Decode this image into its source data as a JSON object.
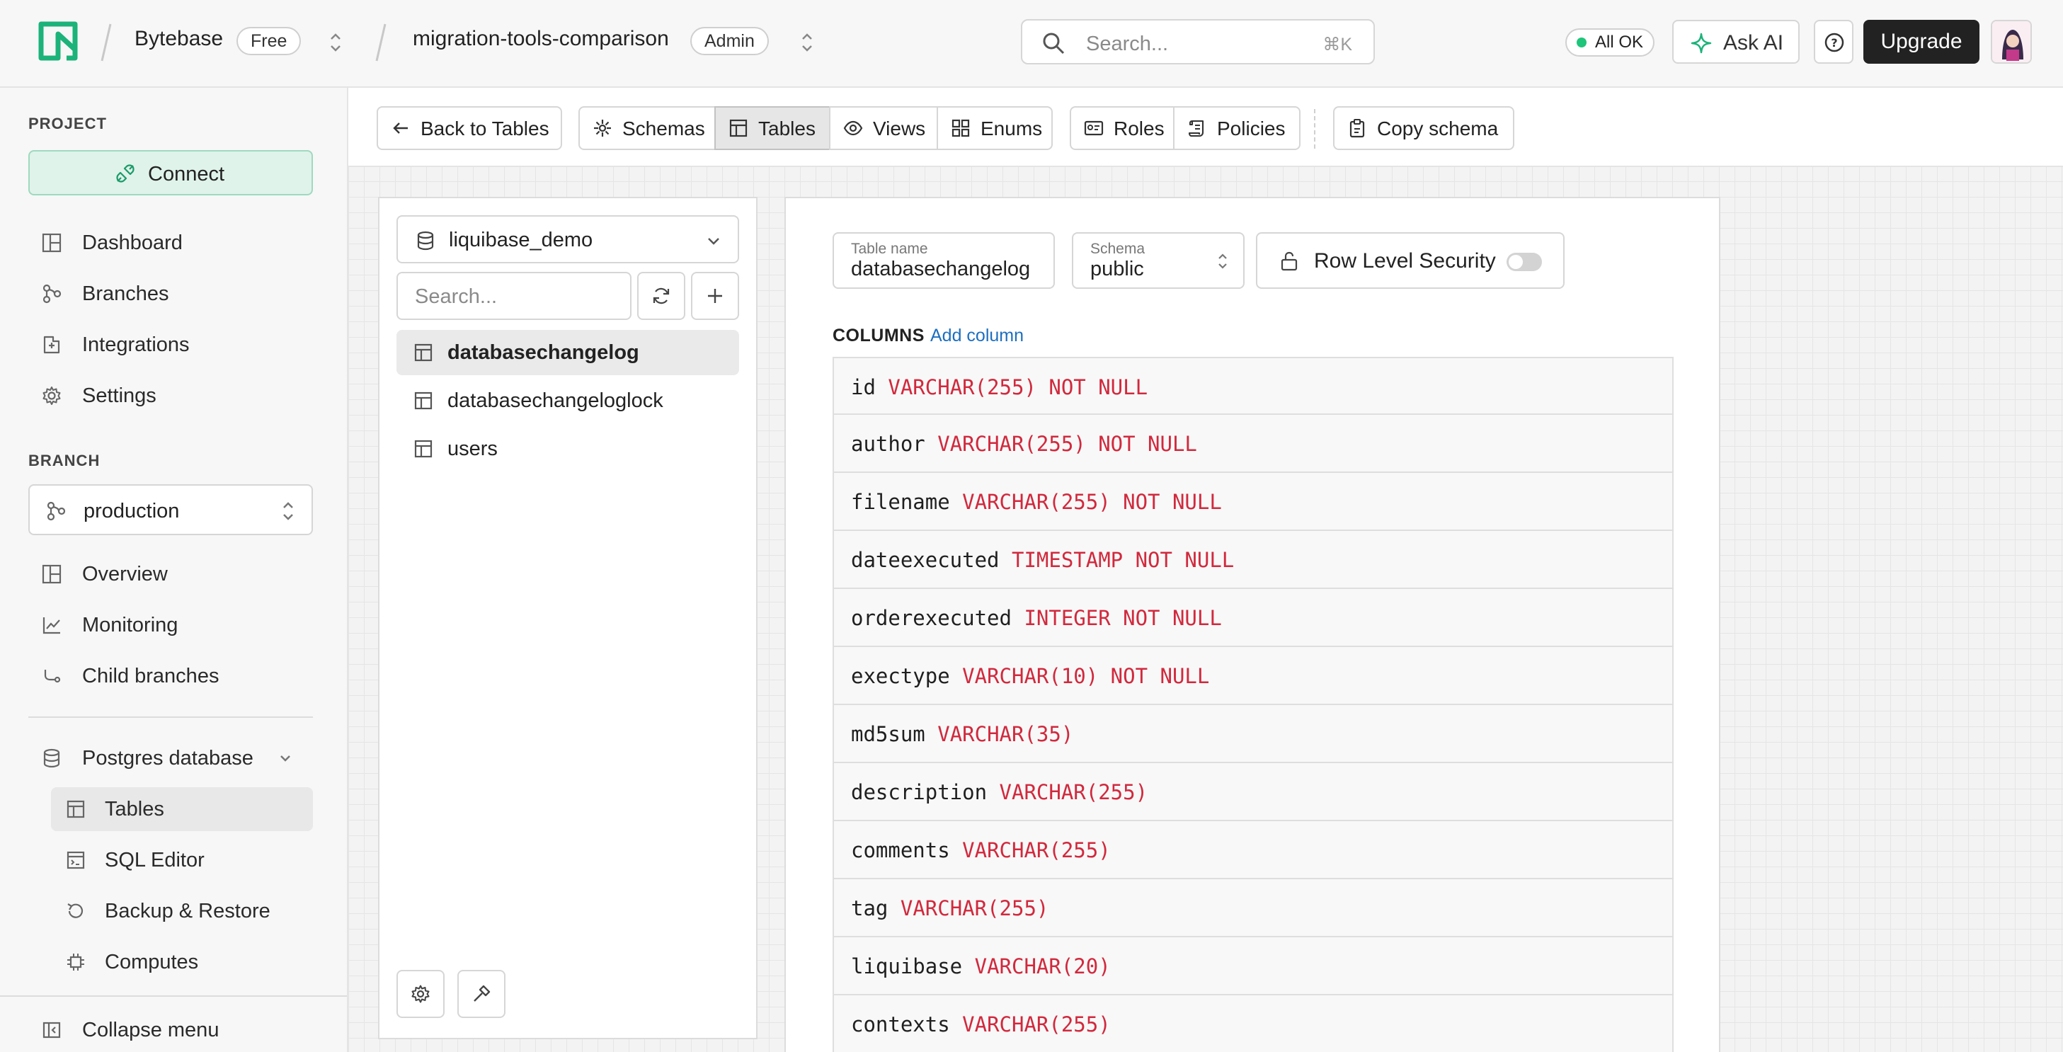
{
  "header": {
    "org_name": "Bytebase",
    "org_plan": "Free",
    "project_name": "migration-tools-comparison",
    "project_role": "Admin",
    "search_placeholder": "Search...",
    "search_shortcut": "⌘K",
    "status": "All OK",
    "ask_ai": "Ask AI",
    "upgrade": "Upgrade"
  },
  "sidebar": {
    "project_label": "PROJECT",
    "connect": "Connect",
    "project_items": [
      {
        "label": "Dashboard",
        "icon": "dashboard-icon"
      },
      {
        "label": "Branches",
        "icon": "branches-icon"
      },
      {
        "label": "Integrations",
        "icon": "integrations-icon"
      },
      {
        "label": "Settings",
        "icon": "gear-icon"
      }
    ],
    "branch_label": "BRANCH",
    "branch_value": "production",
    "branch_items": [
      {
        "label": "Overview",
        "icon": "overview-icon"
      },
      {
        "label": "Monitoring",
        "icon": "monitoring-icon"
      },
      {
        "label": "Child branches",
        "icon": "child-branch-icon"
      }
    ],
    "database_label": "Postgres database",
    "database_items": [
      {
        "label": "Tables",
        "icon": "table-icon",
        "active": true
      },
      {
        "label": "SQL Editor",
        "icon": "sql-editor-icon"
      },
      {
        "label": "Backup & Restore",
        "icon": "restore-icon"
      },
      {
        "label": "Computes",
        "icon": "chip-icon"
      }
    ],
    "collapse": "Collapse menu"
  },
  "toolbar": {
    "back": "Back to Tables",
    "schemas": "Schemas",
    "tables": "Tables",
    "views": "Views",
    "enums": "Enums",
    "roles": "Roles",
    "policies": "Policies",
    "copy_schema": "Copy schema"
  },
  "tables_panel": {
    "database": "liquibase_demo",
    "search_placeholder": "Search...",
    "tables": [
      "databasechangelog",
      "databasechangeloglock",
      "users"
    ],
    "active_table": "databasechangelog"
  },
  "detail": {
    "table_name_caption": "Table name",
    "table_name": "databasechangelog",
    "schema_caption": "Schema",
    "schema": "public",
    "rls_label": "Row Level Security",
    "rls_enabled": false,
    "columns_title": "COLUMNS",
    "add_column": "Add column",
    "columns": [
      {
        "name": "id",
        "type": "VARCHAR(255) NOT NULL"
      },
      {
        "name": "author",
        "type": "VARCHAR(255) NOT NULL"
      },
      {
        "name": "filename",
        "type": "VARCHAR(255) NOT NULL"
      },
      {
        "name": "dateexecuted",
        "type": "TIMESTAMP NOT NULL"
      },
      {
        "name": "orderexecuted",
        "type": "INTEGER NOT NULL"
      },
      {
        "name": "exectype",
        "type": "VARCHAR(10) NOT NULL"
      },
      {
        "name": "md5sum",
        "type": "VARCHAR(35)"
      },
      {
        "name": "description",
        "type": "VARCHAR(255)"
      },
      {
        "name": "comments",
        "type": "VARCHAR(255)"
      },
      {
        "name": "tag",
        "type": "VARCHAR(255)"
      },
      {
        "name": "liquibase",
        "type": "VARCHAR(20)"
      },
      {
        "name": "contexts",
        "type": "VARCHAR(255)"
      }
    ]
  },
  "colors": {
    "accent_green": "#1ec57a",
    "type_red": "#d1293d",
    "link_blue": "#1d6fbf",
    "dark_button": "#222222"
  }
}
